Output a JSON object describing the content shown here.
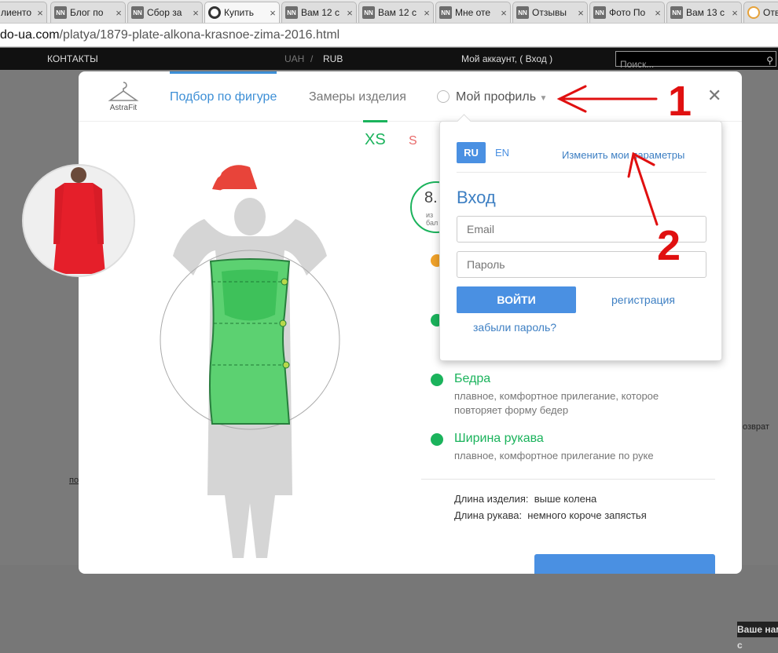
{
  "tabs": [
    {
      "title": "лиенто"
    },
    {
      "title": "Блог по"
    },
    {
      "title": "Сбор за"
    },
    {
      "title": "Купить"
    },
    {
      "title": "Вам 12 с"
    },
    {
      "title": "Вам 12 с"
    },
    {
      "title": "Мне оте"
    },
    {
      "title": "Отзывы"
    },
    {
      "title": "Фото По"
    },
    {
      "title": "Вам 13 с"
    },
    {
      "title": "Отв"
    }
  ],
  "url": {
    "domain": "do-ua.com",
    "path": "/platya/1879-plate-alkona-krasnoe-zima-2016.html"
  },
  "topnav": {
    "contacts": "КОНТАКТЫ",
    "uah": "UAH",
    "sep": "/",
    "rub": "RUB",
    "account": "Мой аккаунт, ( Вход )",
    "search_placeholder": "Поиск..."
  },
  "page_bg": {
    "left_link": "по",
    "right_text": "озврат",
    "footer": "Ваше нам с"
  },
  "modal": {
    "logo": "AstraFit",
    "nav": {
      "figure": "Подбор по фигуре",
      "measures": "Замеры изделия",
      "profile": "Мой профиль"
    },
    "sizes": {
      "active": "XS",
      "other": "S"
    },
    "score": {
      "value": "8.",
      "sub1": "из",
      "sub2": "бал"
    },
    "fits": [
      {
        "name": "Бедра",
        "desc": "плавное, комфортное прилегание, которое повторяет форму бедер"
      },
      {
        "name": "Ширина рукава",
        "desc": "плавное, комфортное прилегание по руке"
      }
    ],
    "lengths": [
      {
        "label": "Длина изделия:",
        "value": "выше колена"
      },
      {
        "label": "Длина рукава:",
        "value": "немного короче запястья"
      }
    ]
  },
  "dropdown": {
    "lang_ru": "RU",
    "lang_en": "EN",
    "change_params": "Изменить мои параметры",
    "login_title": "Вход",
    "email_placeholder": "Email",
    "password_placeholder": "Пароль",
    "login_button": "ВОЙТИ",
    "register": "регистрация",
    "forgot": "забыли пароль?"
  },
  "annotations": {
    "one": "1",
    "two": "2"
  },
  "colors": {
    "accent_green": "#1bb35c",
    "accent_blue": "#4a90e2",
    "annotation_red": "#e01010"
  }
}
